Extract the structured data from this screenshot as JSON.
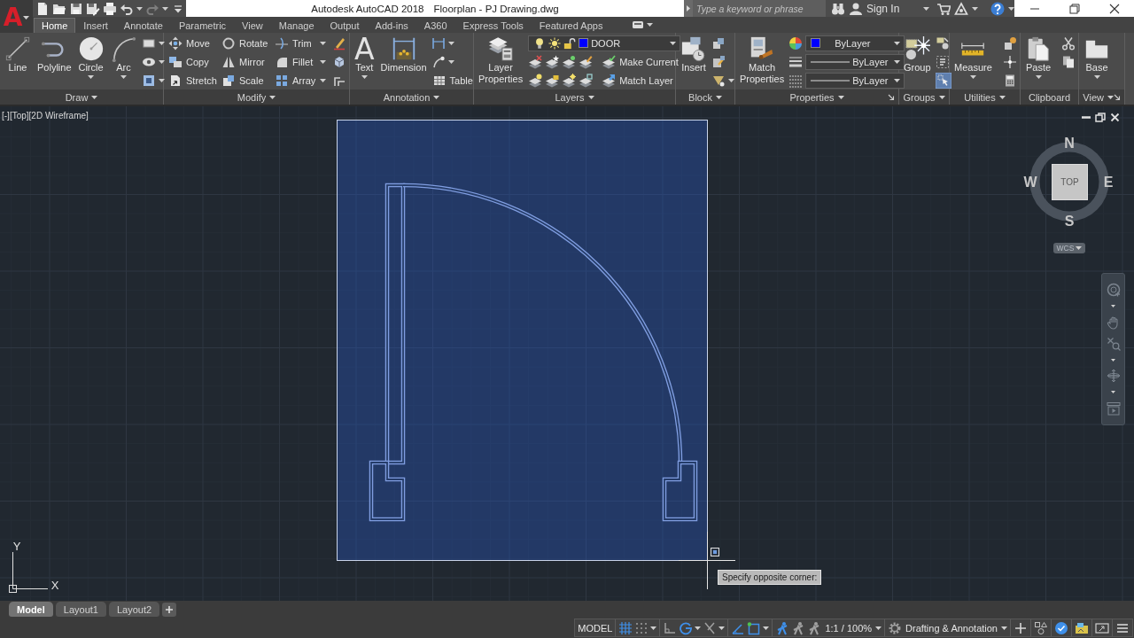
{
  "app_menu": {
    "logo": "A"
  },
  "quick_access": {
    "redo": {
      "disabled": true
    }
  },
  "title_bar": {
    "app": "Autodesk AutoCAD 2018",
    "document": "Floorplan - PJ Drawing.dwg"
  },
  "search": {
    "placeholder": "Type a keyword or phrase"
  },
  "account": {
    "label": "Sign In"
  },
  "ribbon": {
    "tabs": [
      {
        "label": "Home",
        "selected": true
      },
      {
        "label": "Insert",
        "selected": false
      },
      {
        "label": "Annotate",
        "selected": false
      },
      {
        "label": "Parametric",
        "selected": false
      },
      {
        "label": "View",
        "selected": false
      },
      {
        "label": "Manage",
        "selected": false
      },
      {
        "label": "Output",
        "selected": false
      },
      {
        "label": "Add-ins",
        "selected": false
      },
      {
        "label": "A360",
        "selected": false
      },
      {
        "label": "Express Tools",
        "selected": false
      },
      {
        "label": "Featured Apps",
        "selected": false
      }
    ],
    "panels": [
      {
        "title": "Draw",
        "buttons": [
          "Line",
          "Polyline",
          "Circle",
          "Arc"
        ]
      },
      {
        "title": "Modify",
        "buttons": [
          "Move",
          "Copy",
          "Stretch",
          "Rotate",
          "Mirror",
          "Scale",
          "Trim",
          "Fillet",
          "Array"
        ]
      },
      {
        "title": "Annotation",
        "text_glyph": "A",
        "buttons": [
          "Text",
          "Dimension",
          "Table"
        ]
      },
      {
        "title": "Layers",
        "buttons": [
          "Layer Properties",
          "Make Current",
          "Match Layer"
        ],
        "layer": {
          "name": "DOOR",
          "color": "#0000ff"
        }
      },
      {
        "title": "Block",
        "buttons": [
          "Insert"
        ]
      },
      {
        "title": "Properties",
        "buttons": [
          "Match Properties"
        ],
        "color": {
          "value": "ByLayer",
          "color": "#0000ff"
        },
        "lineweight": "ByLayer",
        "linetype": "ByLayer"
      },
      {
        "title": "Groups",
        "buttons": [
          "Group"
        ],
        "group_selection": {
          "on": true
        }
      },
      {
        "title": "Utilities",
        "buttons": [
          "Measure"
        ]
      },
      {
        "title": "Clipboard",
        "buttons": [
          "Paste"
        ]
      },
      {
        "title": "View",
        "buttons": [
          "Base"
        ]
      }
    ]
  },
  "viewport": {
    "controls": [
      "[-]",
      "[Top]",
      "[2D Wireframe]"
    ],
    "viewcube": {
      "face": "TOP",
      "north": "N",
      "south": "S",
      "east": "E",
      "west": "W",
      "ucs": "WCS"
    },
    "ucs_icon": {
      "x": "X",
      "y": "Y"
    },
    "tooltip": "Specify opposite corner:"
  },
  "layout_tabs": [
    {
      "label": "Model",
      "selected": true
    },
    {
      "label": "Layout1",
      "selected": false
    },
    {
      "label": "Layout2",
      "selected": false
    }
  ],
  "status_bar": {
    "space": "MODEL",
    "toggles": [
      {
        "on": true
      },
      {
        "on": false
      },
      {
        "on": false
      },
      {
        "on": true
      },
      {
        "on": false
      },
      {
        "on": true
      },
      {
        "on": true
      },
      {
        "on": true
      },
      {
        "on": false
      },
      {
        "on": false
      }
    ],
    "scale": "1:1 / 100%",
    "workspace": "Drafting & Annotation",
    "hardware_acceleration": {
      "on": true
    }
  }
}
